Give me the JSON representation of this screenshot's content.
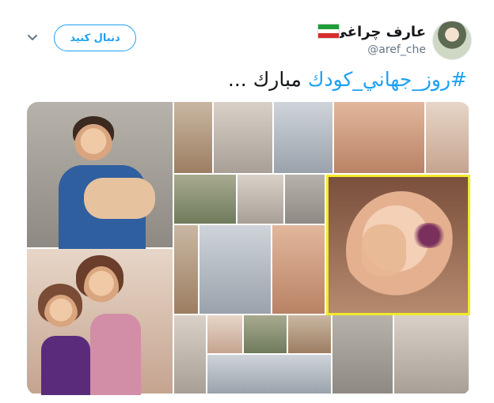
{
  "tweet": {
    "author_name": "عارف چراغی",
    "handle": "@aref_che",
    "follow_label": "دنبال کنید",
    "text_hashtag": "#روز_جهاني_كودك",
    "text_rest": " مبارك ..."
  },
  "icons": {
    "chevron": "chevron-down-icon",
    "flag": "iran-flag-icon"
  },
  "colors": {
    "accent": "#1da1f2",
    "text": "#14171a",
    "muted": "#657786"
  }
}
